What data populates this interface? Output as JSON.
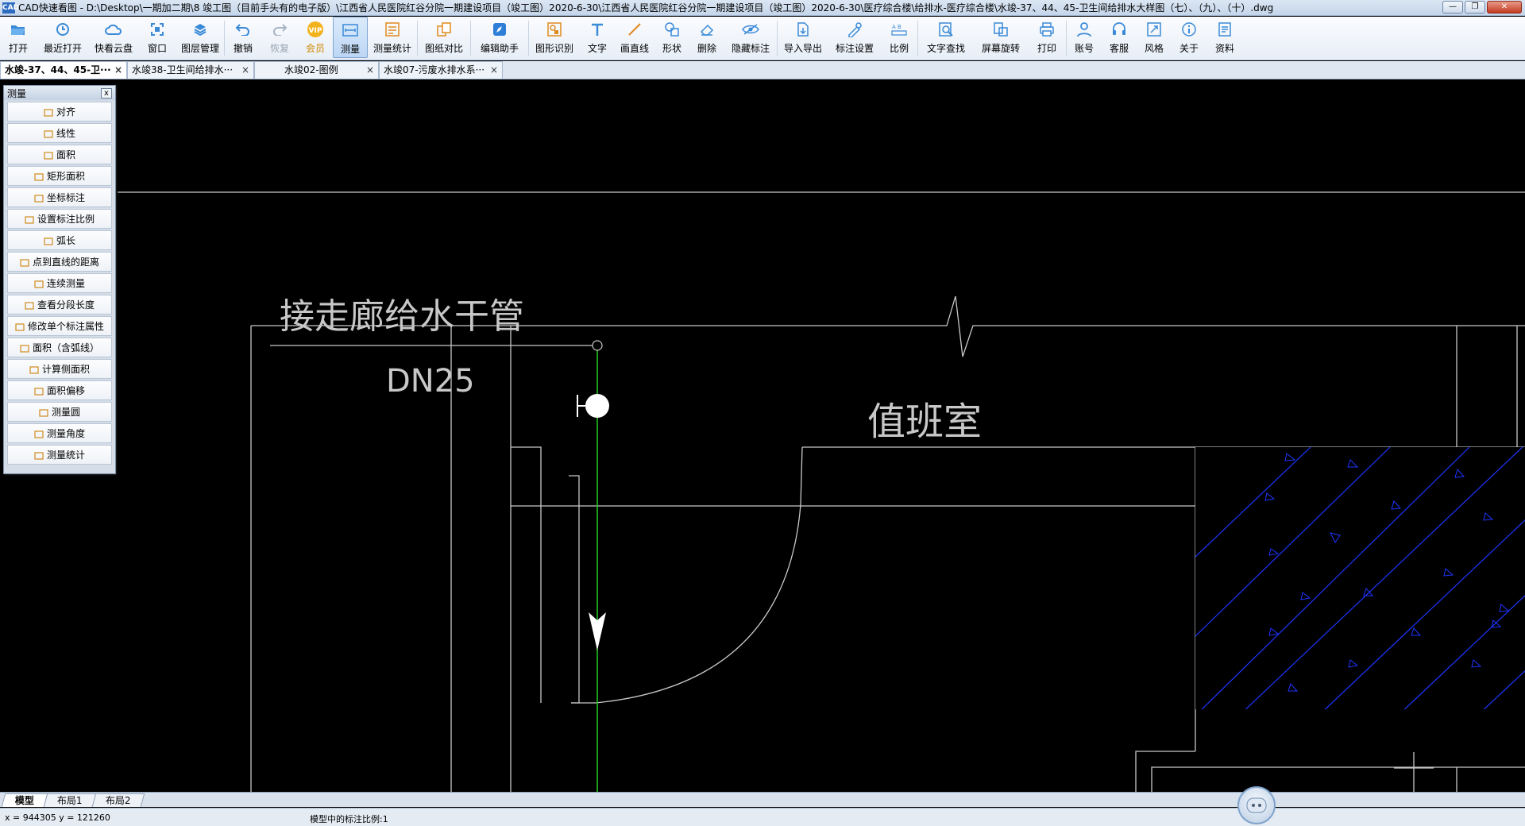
{
  "titlebar": {
    "app_badge": "CAD",
    "title": "CAD快速看图 - D:\\Desktop\\一期加二期\\8 竣工图（目前手头有的电子版）\\江西省人民医院红谷分院一期建设项目（竣工图）2020-6-30\\江西省人民医院红谷分院一期建设项目（竣工图）2020-6-30\\医疗综合楼\\给排水-医疗综合楼\\水竣-37、44、45-卫生间给排水大样图（七）、（九）、（十）.dwg",
    "minimize": "—",
    "maximize": "❐",
    "close": "✕"
  },
  "toolbar": {
    "items": [
      {
        "label": "打开",
        "icon": "folder-open-icon"
      },
      {
        "label": "最近打开",
        "icon": "recent-clock-icon"
      },
      {
        "label": "快看云盘",
        "icon": "cloud-icon"
      },
      {
        "label": "窗口",
        "icon": "window-icon"
      },
      {
        "label": "图层管理",
        "icon": "layers-icon"
      },
      {
        "label": "撤销",
        "icon": "undo-icon"
      },
      {
        "label": "恢复",
        "icon": "redo-icon"
      },
      {
        "label": "会员",
        "icon": "vip-icon",
        "badge": "VIP"
      },
      {
        "label": "测量",
        "icon": "measure-icon"
      },
      {
        "label": "测量统计",
        "icon": "measure-stats-icon"
      },
      {
        "label": "图纸对比",
        "icon": "compare-icon"
      },
      {
        "label": "编辑助手",
        "icon": "edit-assistant-icon"
      },
      {
        "label": "图形识别",
        "icon": "shape-recognize-icon"
      },
      {
        "label": "文字",
        "icon": "text-icon"
      },
      {
        "label": "画直线",
        "icon": "line-icon"
      },
      {
        "label": "形状",
        "icon": "shape-icon"
      },
      {
        "label": "删除",
        "icon": "eraser-icon"
      },
      {
        "label": "隐藏标注",
        "icon": "hide-annotation-icon"
      },
      {
        "label": "导入导出",
        "icon": "import-export-icon"
      },
      {
        "label": "标注设置",
        "icon": "annotation-settings-icon"
      },
      {
        "label": "比例",
        "icon": "scale-icon"
      },
      {
        "label": "文字查找",
        "icon": "text-search-icon"
      },
      {
        "label": "屏幕旋转",
        "icon": "screen-rotate-icon"
      },
      {
        "label": "打印",
        "icon": "printer-icon"
      },
      {
        "label": "账号",
        "icon": "account-icon"
      },
      {
        "label": "客服",
        "icon": "headset-icon"
      },
      {
        "label": "风格",
        "icon": "style-icon"
      },
      {
        "label": "关于",
        "icon": "info-icon"
      },
      {
        "label": "资料",
        "icon": "docs-icon"
      }
    ]
  },
  "tabs": [
    {
      "label": "水竣-37、44、45-卫···",
      "close": "×"
    },
    {
      "label": "水竣38-卫生间给排水···",
      "close": "×"
    },
    {
      "label": "水竣02-图例",
      "close": "×"
    },
    {
      "label": "水竣07-污废水排水系···",
      "close": "×"
    }
  ],
  "measure_panel": {
    "title": "测量",
    "close": "x",
    "items": [
      "对齐",
      "线性",
      "面积",
      "矩形面积",
      "坐标标注",
      "设置标注比例",
      "弧长",
      "点到直线的距离",
      "连续测量",
      "查看分段长度",
      "修改单个标注属性",
      "面积（含弧线）",
      "计算侧面积",
      "面积偏移",
      "测量圆",
      "测量角度",
      "测量统计"
    ]
  },
  "drawing": {
    "label_pipe": "接走廊给水干管",
    "label_dn": "DN25",
    "label_room": "值班室",
    "hatch_color": "#1e35ff",
    "line_color": "#c8c8c8",
    "pipe_color": "#22cc22"
  },
  "layout_tabs": [
    "模型",
    "布局1",
    "布局2"
  ],
  "status": {
    "coords": "x = 944305  y = 121260",
    "scale": "模型中的标注比例:1"
  }
}
